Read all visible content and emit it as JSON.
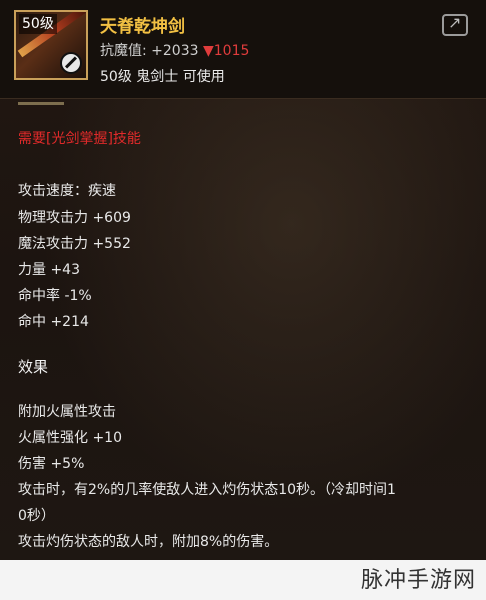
{
  "item": {
    "level_tag": "50级",
    "name": "天脊乾坤剑",
    "resist_label": "抗魔值:",
    "resist_value": "+2033",
    "resist_down": "▼1015",
    "requirement": "50级 鬼剑士 可使用"
  },
  "icons": {
    "share": "share-icon",
    "forbid": "forbid-icon"
  },
  "skill_req": "需要[光剑掌握]技能",
  "stats": [
    "攻击速度：疾速",
    "物理攻击力 +609",
    "魔法攻击力 +552",
    "力量 +43",
    "命中率 -1%",
    "命中 +214"
  ],
  "effect": {
    "title": "效果",
    "lines": [
      "附加火属性攻击",
      "火属性强化 +10",
      "伤害 +5%",
      "攻击时，有2%的几率使敌人进入灼伤状态10秒。（冷却时间1",
      "0秒）",
      "攻击灼伤状态的敌人时，附加8%的伤害。"
    ]
  },
  "watermark": "脉冲手游网",
  "colors": {
    "title": "#f2c043",
    "skill": "#e02a2a",
    "down": "#e03c3c",
    "frame": "#c9a05a"
  }
}
